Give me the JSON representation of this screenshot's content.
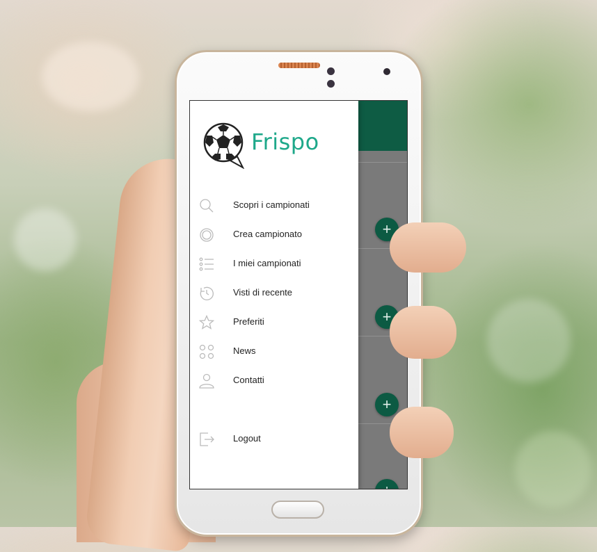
{
  "app": {
    "name": "Frispo",
    "brand_color": "#1ea88a",
    "appbar_color": "#0e5c44"
  },
  "drawer": {
    "items": [
      {
        "label": "Scopri i campionati",
        "icon": "search-icon"
      },
      {
        "label": "Crea campionato",
        "icon": "ring-icon"
      },
      {
        "label": "I miei campionati",
        "icon": "list-icon"
      },
      {
        "label": "Visti di recente",
        "icon": "history-icon"
      },
      {
        "label": "Preferiti",
        "icon": "star-icon"
      },
      {
        "label": "News",
        "icon": "grid-icon"
      },
      {
        "label": "Contatti",
        "icon": "person-icon"
      }
    ],
    "logout": {
      "label": "Logout",
      "icon": "logout-icon"
    }
  },
  "background_list": {
    "add_button_symbol": "+"
  }
}
